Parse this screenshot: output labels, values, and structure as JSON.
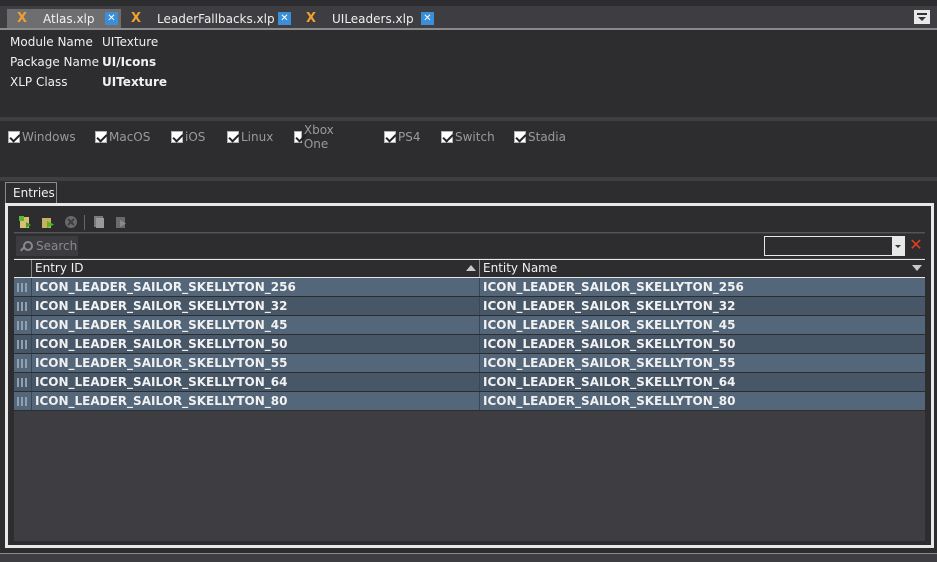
{
  "tabs": [
    {
      "label": "Atlas.xlp",
      "icon": "xlp-file-icon",
      "active": true
    },
    {
      "label": "LeaderFallbacks.xlp",
      "icon": "xlp-file-icon",
      "active": false
    },
    {
      "label": "UILeaders.xlp",
      "icon": "xlp-file-icon",
      "active": false
    }
  ],
  "properties": {
    "module_name_label": "Module Name",
    "module_name_value": "UITexture",
    "package_name_label": "Package Name",
    "package_name_value": "UI/Icons",
    "xlp_class_label": "XLP Class",
    "xlp_class_value": "UITexture"
  },
  "platforms": [
    {
      "label": "Windows",
      "checked": true
    },
    {
      "label": "MacOS",
      "checked": true
    },
    {
      "label": "iOS",
      "checked": true
    },
    {
      "label": "Linux",
      "checked": true
    },
    {
      "label": "Xbox One",
      "checked": true
    },
    {
      "label": "PS4",
      "checked": true
    },
    {
      "label": "Switch",
      "checked": true
    },
    {
      "label": "Stadia",
      "checked": true
    }
  ],
  "entries": {
    "tab_label": "Entries",
    "search_label": "Search",
    "filter_value": "",
    "columns": [
      "Entry ID",
      "Entity Name"
    ],
    "rows": [
      [
        "ICON_LEADER_SAILOR_SKELLYTON_256",
        "ICON_LEADER_SAILOR_SKELLYTON_256"
      ],
      [
        "ICON_LEADER_SAILOR_SKELLYTON_32",
        "ICON_LEADER_SAILOR_SKELLYTON_32"
      ],
      [
        "ICON_LEADER_SAILOR_SKELLYTON_45",
        "ICON_LEADER_SAILOR_SKELLYTON_45"
      ],
      [
        "ICON_LEADER_SAILOR_SKELLYTON_50",
        "ICON_LEADER_SAILOR_SKELLYTON_50"
      ],
      [
        "ICON_LEADER_SAILOR_SKELLYTON_55",
        "ICON_LEADER_SAILOR_SKELLYTON_55"
      ],
      [
        "ICON_LEADER_SAILOR_SKELLYTON_64",
        "ICON_LEADER_SAILOR_SKELLYTON_64"
      ],
      [
        "ICON_LEADER_SAILOR_SKELLYTON_80",
        "ICON_LEADER_SAILOR_SKELLYTON_80"
      ]
    ]
  },
  "colors": {
    "background": "#2d2d30",
    "row_odd": "#54667a",
    "row_even": "#475768",
    "close_badge": "#3a8fd8",
    "xlp_icon": "#f0a030",
    "clear_filter": "#e0401e"
  }
}
